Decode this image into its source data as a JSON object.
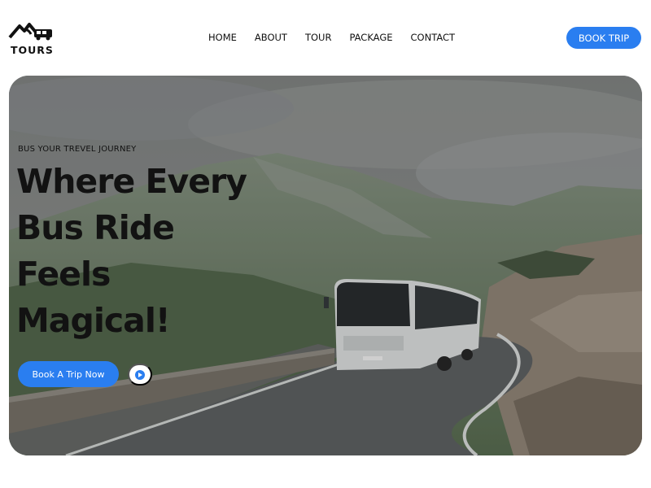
{
  "brand": {
    "logo_icon": "mountain-bus-logo-icon",
    "name": "TOURS"
  },
  "nav": {
    "items": [
      {
        "label": "HOME"
      },
      {
        "label": "ABOUT"
      },
      {
        "label": "TOUR"
      },
      {
        "label": "PACKAGE"
      },
      {
        "label": "CONTACT"
      }
    ],
    "cta_label": "BOOK TRIP"
  },
  "hero": {
    "eyebrow": "BUS YOUR TREVEL JOURNEY",
    "headline": [
      "Where Every",
      "Bus Ride",
      "Feels",
      "Magical!"
    ],
    "cta_label": "Book A Trip Now",
    "play_icon": "play-icon"
  },
  "colors": {
    "accent": "#2a7ef0",
    "text": "#121212",
    "background": "#ffffff"
  }
}
